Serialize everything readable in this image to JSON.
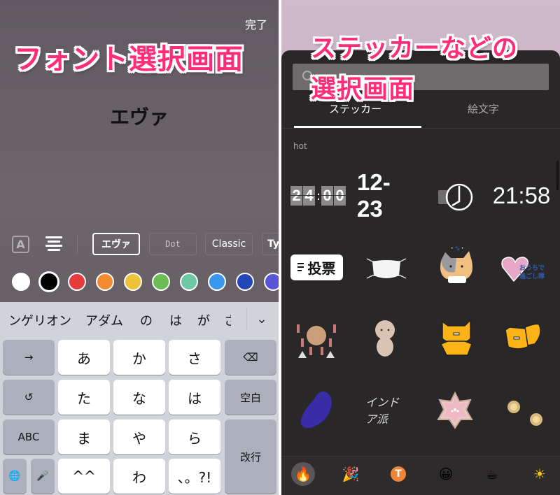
{
  "left_panel": {
    "overlay_title": "フォント選択画面",
    "done_label": "完了",
    "preview_text": "エヴァ",
    "toolbar": {
      "text_style_icon": "A",
      "align_icon": "align-center-icon",
      "fonts": [
        {
          "label": "エヴァ",
          "selected": true
        },
        {
          "label": "Dot",
          "selected": false
        },
        {
          "label": "Classic",
          "selected": false
        },
        {
          "label": "Ty",
          "selected": false
        }
      ]
    },
    "colors": [
      "#ffffff",
      "#000000",
      "#e53b3b",
      "#f48a30",
      "#efc337",
      "#6abf54",
      "#6dc8a3",
      "#3a97ee",
      "#2347b6",
      "#5a55d6"
    ],
    "selected_color": "#000000",
    "keyboard": {
      "suggestions": [
        "ンゲリオン",
        "アダム",
        "の",
        "は",
        "が",
        "さ"
      ],
      "rows": [
        [
          "→",
          "あ",
          "か",
          "さ",
          "⌫"
        ],
        [
          "↺",
          "た",
          "な",
          "は",
          "空白"
        ],
        [
          "ABC",
          "ま",
          "や",
          "ら",
          "改行"
        ],
        [
          "🌐",
          "🎤",
          "^^",
          "わ",
          "、。?!"
        ]
      ],
      "expand_icon": "chevron-down-icon"
    }
  },
  "right_panel": {
    "overlay_title_line1": "ステッカーなどの",
    "overlay_title_line2": "選択画面",
    "search_placeholder": "",
    "tabs": [
      {
        "label": "ステッカー",
        "active": true
      },
      {
        "label": "絵文字",
        "active": false
      }
    ],
    "section_label": "hot",
    "stickers": {
      "flip_clock": [
        "2",
        "4",
        "0",
        "0"
      ],
      "date": "12-23",
      "clock_icon": "analog-clock-icon",
      "time": "21:58",
      "poll_label": "投票",
      "mask": "mask-sticker",
      "cat": "calico-cat-sticker",
      "stay_home": "おうちで過ごし隊",
      "pomeranian": "pomeranian-sticker",
      "poodle": "poodle-sticker",
      "yellow_cat_1": "yellow-cat-sticker",
      "yellow_cat_2": "yellow-cat-sleeping-sticker",
      "purple_blob": "purple-glitter-sticker",
      "script_text": "インドア派",
      "sakura_cookie": "sakura-cookie-sticker",
      "flower_cookies": "flower-cookies-sticker"
    },
    "categories": [
      {
        "icon": "🔥",
        "name": "fire-icon",
        "active": true
      },
      {
        "icon": "🎉",
        "name": "party-popper-icon",
        "active": false
      },
      {
        "icon": "T",
        "name": "text-t-icon",
        "active": false
      },
      {
        "icon": "😀",
        "name": "grinning-face-icon",
        "active": false
      },
      {
        "icon": "☕",
        "name": "coffee-icon",
        "active": false
      },
      {
        "icon": "☀",
        "name": "sun-icon",
        "active": false
      }
    ]
  }
}
